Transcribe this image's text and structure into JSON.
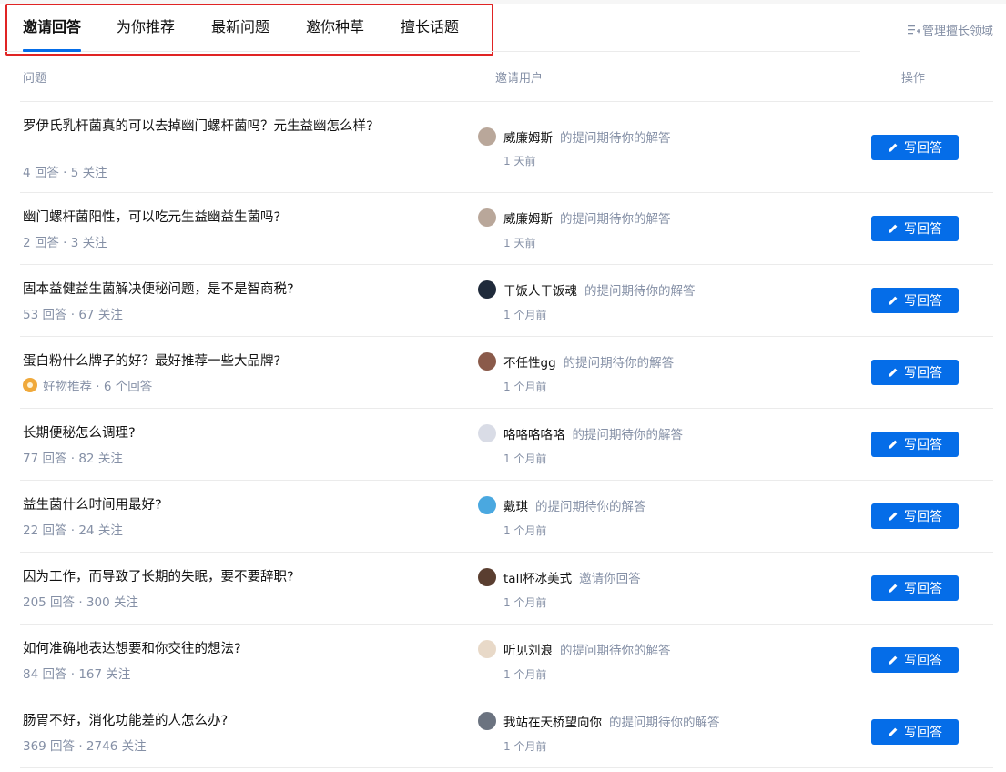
{
  "tabs": [
    {
      "label": "邀请回答",
      "active": true
    },
    {
      "label": "为你推荐",
      "active": false
    },
    {
      "label": "最新问题",
      "active": false
    },
    {
      "label": "邀你种草",
      "active": false
    },
    {
      "label": "擅长话题",
      "active": false
    }
  ],
  "manage_label": "管理擅长领域",
  "headers": {
    "question": "问题",
    "invited_user": "邀请用户",
    "action": "操作"
  },
  "colors": {
    "accent": "#056de8",
    "highlight_box": "#e02424",
    "muted": "#8590a6"
  },
  "rows": [
    {
      "title": "罗伊氏乳杆菌真的可以去掉幽门螺杆菌吗？元生益幽怎么样?",
      "meta": "4 回答 · 5 关注",
      "user": "威廉姆斯",
      "msg": "的提问期待你的解答",
      "time": "1 天前",
      "button": "写回答",
      "avatar_color": "#b9a79a"
    },
    {
      "title": "幽门螺杆菌阳性，可以吃元生益幽益生菌吗?",
      "meta": "2 回答 · 3 关注",
      "user": "威廉姆斯",
      "msg": "的提问期待你的解答",
      "time": "1 天前",
      "button": "写回答",
      "avatar_color": "#b9a79a"
    },
    {
      "title": "固本益健益生菌解决便秘问题，是不是智商税?",
      "meta": "53 回答 · 67 关注",
      "user": "干饭人干饭魂",
      "msg": "的提问期待你的解答",
      "time": "1 个月前",
      "button": "写回答",
      "avatar_color": "#1f2a3a"
    },
    {
      "title": "蛋白粉什么牌子的好？最好推荐一些大品牌?",
      "meta": "好物推荐 · 6 个回答",
      "meta_icon": "medal-icon",
      "user": "不任性gg",
      "msg": "的提问期待你的解答",
      "time": "1 个月前",
      "button": "写回答",
      "avatar_color": "#8a5a4a"
    },
    {
      "title": "长期便秘怎么调理?",
      "meta": "77 回答 · 82 关注",
      "user": "咯咯咯咯咯",
      "msg": "的提问期待你的解答",
      "time": "1 个月前",
      "button": "写回答",
      "avatar_color": "#d9dce6"
    },
    {
      "title": "益生菌什么时间用最好?",
      "meta": "22 回答 · 24 关注",
      "user": "戴琪",
      "msg": "的提问期待你的解答",
      "time": "1 个月前",
      "button": "写回答",
      "avatar_color": "#4aa8e0"
    },
    {
      "title": "因为工作，而导致了长期的失眠，要不要辞职?",
      "meta": "205 回答 · 300 关注",
      "user": "tall杯冰美式",
      "msg": "邀请你回答",
      "time": "1 个月前",
      "button": "写回答",
      "avatar_color": "#5a3e30"
    },
    {
      "title": "如何准确地表达想要和你交往的想法?",
      "meta": "84 回答 · 167 关注",
      "user": "听见刘浪",
      "msg": "的提问期待你的解答",
      "time": "1 个月前",
      "button": "写回答",
      "avatar_color": "#e8d9c8"
    },
    {
      "title": "肠胃不好，消化功能差的人怎么办?",
      "meta": "369 回答 · 2746 关注",
      "user": "我站在天桥望向你",
      "msg": "的提问期待你的解答",
      "time": "1 个月前",
      "button": "写回答",
      "avatar_color": "#6b7380"
    }
  ]
}
